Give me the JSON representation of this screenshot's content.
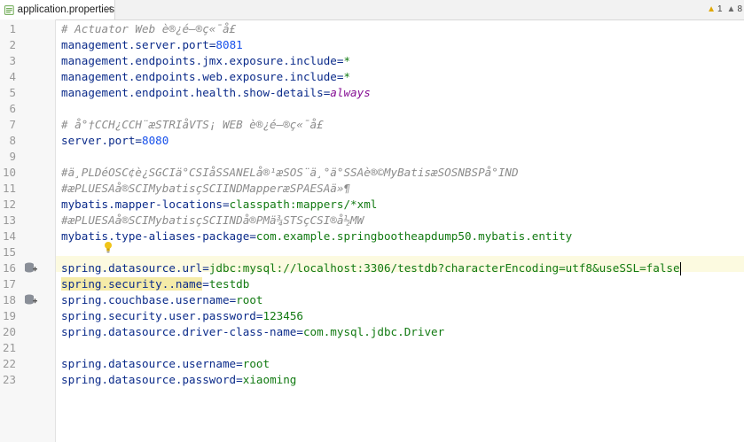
{
  "tab": {
    "label": "application.properties",
    "close": "×"
  },
  "inspections": {
    "warnings": "1",
    "weak": "8"
  },
  "lines": [
    {
      "no": "1",
      "comment": "# Actuator Web è®¿é—®ç«¯å£"
    },
    {
      "no": "2",
      "key": "management.server.port",
      "value": "8081",
      "vtype": "num"
    },
    {
      "no": "3",
      "key": "management.endpoints.jmx.exposure.include",
      "value": "*",
      "vtype": "v"
    },
    {
      "no": "4",
      "key": "management.endpoints.web.exposure.include",
      "value": "*",
      "vtype": "v"
    },
    {
      "no": "5",
      "key": "management.endpoint.health.show-details",
      "value": "always",
      "vtype": "kw"
    },
    {
      "no": "6"
    },
    {
      "no": "7",
      "comment": "# å°†CCH¿CCH¨æSTRIåVTS¡ WEB è®¿é—®ç«¯å£"
    },
    {
      "no": "8",
      "key": "server.port",
      "value": "8080",
      "vtype": "num"
    },
    {
      "no": "9"
    },
    {
      "no": "10",
      "comment": "#ä¸PLDéOSC¢è¿SGCIä°CSIåSSANELå®¹æSOS¨ä¸°ä°SSAè®©MyBatisæSOSNBSPå°IND"
    },
    {
      "no": "11",
      "comment": "#æPLUESAå®SCIMybatisçSCIINDMapperæSPAESAä»¶"
    },
    {
      "no": "12",
      "key": "mybatis.mapper-locations",
      "value": "classpath:mappers/*xml",
      "vtype": "v"
    },
    {
      "no": "13",
      "comment": "#æPLUESAå®SCIMybatisçSCIINDå®PMä¾STSçCSI®å½MW"
    },
    {
      "no": "14",
      "key": "mybatis.type-aliases-package",
      "value": "com.example.springbootheapdump50.mybatis.entity",
      "vtype": "v"
    },
    {
      "no": "15"
    },
    {
      "no": "16",
      "key": "spring.datasource.url",
      "value": "jdbc:mysql://localhost:3306/testdb?characterEncoding=utf8&useSSL=false",
      "vtype": "v",
      "caret": true
    },
    {
      "no": "17",
      "key": "spring.security..name",
      "value": "testdb",
      "vtype": "v",
      "highlight": true
    },
    {
      "no": "18",
      "key": "spring.couchbase.username",
      "value": "root",
      "vtype": "v"
    },
    {
      "no": "19",
      "key": "spring.security.user.password",
      "value": "123456",
      "vtype": "v"
    },
    {
      "no": "20",
      "key": "spring.datasource.driver-class-name",
      "value": "com.mysql.jdbc.Driver",
      "vtype": "v"
    },
    {
      "no": "21"
    },
    {
      "no": "22",
      "key": "spring.datasource.username",
      "value": "root",
      "vtype": "v"
    },
    {
      "no": "23",
      "key": "spring.datasource.password",
      "value": "xiaoming",
      "vtype": "v"
    }
  ],
  "colors": {
    "key": "#0b1f8f",
    "value": "#127a12",
    "number": "#1750eb",
    "keyword": "#871094",
    "comment": "#8c8c8c"
  }
}
